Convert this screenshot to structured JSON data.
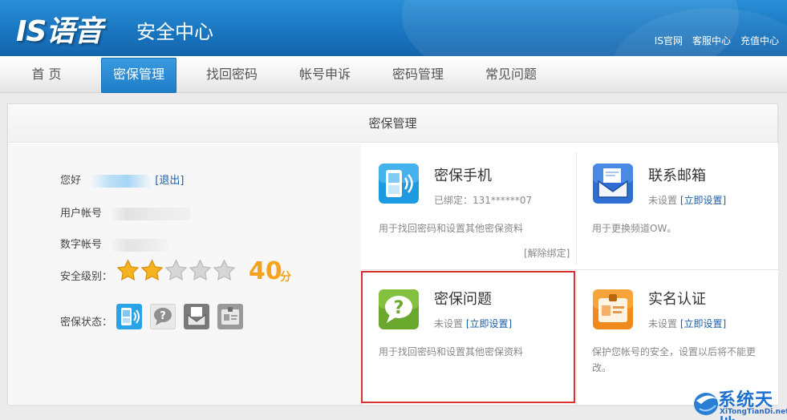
{
  "header": {
    "logo": "IS语音",
    "subtitle": "安全中心",
    "links": [
      "IS官网",
      "客服中心",
      "充值中心"
    ]
  },
  "nav": {
    "items": [
      "首 页",
      "密保管理",
      "找回密码",
      "帐号申诉",
      "密码管理",
      "常见问题"
    ],
    "active": "密保管理"
  },
  "panel": {
    "title": "密保管理"
  },
  "account": {
    "greeting_label": "您好",
    "logout": "[退出]",
    "user_label": "用户帐号",
    "number_label": "数字帐号",
    "level_label": "安全级别：",
    "score": "40",
    "score_unit": "分",
    "rating": {
      "filled": 2,
      "total": 5
    },
    "status_label": "密保状态："
  },
  "cards": {
    "phone": {
      "title": "密保手机",
      "status": "已绑定：131******07",
      "desc": "用于找回密码和设置其他密保资料",
      "action": "[解除绑定]"
    },
    "email": {
      "title": "联系邮箱",
      "status_prefix": "未设置",
      "action": "[立即设置]",
      "desc": "用于更换频道OW。"
    },
    "question": {
      "title": "密保问题",
      "status_prefix": "未设置",
      "action": "[立即设置]",
      "desc": "用于找回密码和设置其他密保资料"
    },
    "realname": {
      "title": "实名认证",
      "status_prefix": "未设置",
      "action": "[立即设置]",
      "desc": "保护您帐号的安全，设置以后将不能更改。"
    }
  },
  "watermark": {
    "title": "系统天地",
    "url": "XiTongTianDi.net"
  },
  "colors": {
    "header_blue": "#1874be",
    "nav_active": "#1d7cc6",
    "link": "#1a5ea8",
    "score": "#f5a31a",
    "highlight_box": "#d9322d"
  }
}
